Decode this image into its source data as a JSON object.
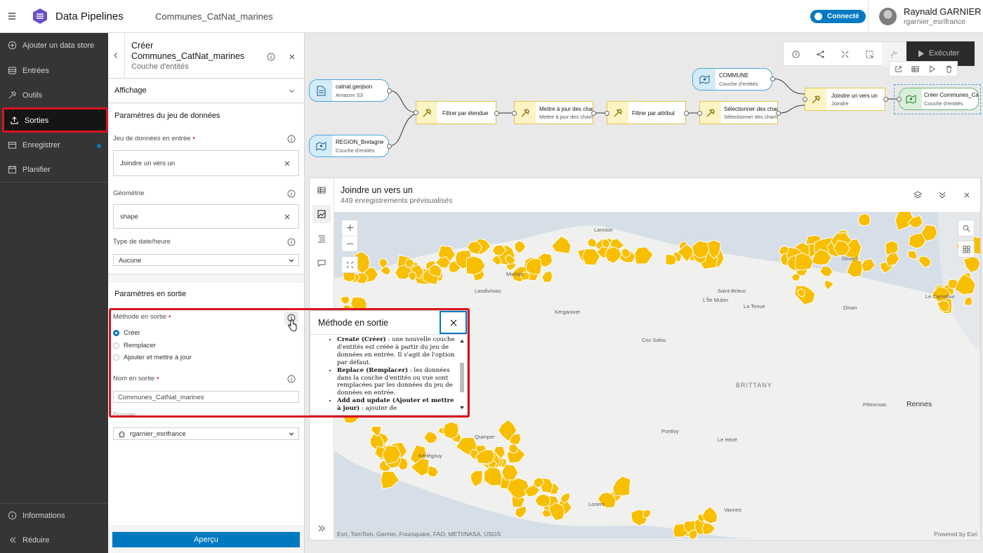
{
  "header": {
    "app_title": "Data Pipelines",
    "pipeline_name": "Communes_CatNat_marines",
    "status_badge": "Connecté",
    "user_name": "Raynald GARNIER",
    "user_login": "rgarnier_esrifrance"
  },
  "sidebar": {
    "items": [
      {
        "label": "Ajouter un data store",
        "icon": "plus-circle-icon"
      },
      {
        "label": "Entrées",
        "icon": "database-icon"
      },
      {
        "label": "Outils",
        "icon": "hammer-icon"
      },
      {
        "label": "Sorties",
        "icon": "export-icon",
        "active": true
      },
      {
        "label": "Enregistrer",
        "icon": "save-icon"
      },
      {
        "label": "Planifier",
        "icon": "calendar-icon"
      }
    ],
    "footer": [
      {
        "label": "Informations",
        "icon": "info-icon"
      },
      {
        "label": "Réduire",
        "icon": "collapse-icon"
      }
    ]
  },
  "panel": {
    "title": "Créer Communes_CatNat_marines",
    "subtitle": "Couche d'entités",
    "display_section": "Affichage",
    "dataset_section": "Paramètres du jeu de données",
    "input_dataset_label": "Jeu de données en entrée",
    "input_dataset_value": "Joindre un vers un",
    "geometry_label": "Géométrie",
    "geometry_value": "shape",
    "datetime_label": "Type de date/heure",
    "datetime_value": "Aucune",
    "output_section": "Paramètres en sortie",
    "output_method_label": "Méthode en sortie",
    "method_options": [
      "Créer",
      "Remplacer",
      "Ajouter et mettre à jour"
    ],
    "output_name_label": "Nom en sortie",
    "output_name_value": "Communes_CatNat_marines",
    "folder_label": "Dossier",
    "folder_value": "rgarnier_esrifrance",
    "preview_button": "Aperçu"
  },
  "toolbar": {
    "execute_label": "Exécuter"
  },
  "diagram": {
    "nodes": [
      {
        "title": "catnat.geojson",
        "subtitle": "Amazon S3"
      },
      {
        "title": "REGION_Bretagne",
        "subtitle": "Couche d'entités"
      },
      {
        "title": "Filtrer par étendue",
        "subtitle": ""
      },
      {
        "title": "Mettre à jour des champs",
        "subtitle": "Mettre à jour des champs"
      },
      {
        "title": "Filtrer par attribut",
        "subtitle": ""
      },
      {
        "title": "Sélectionner des champs",
        "subtitle": "Sélectionner des champs"
      },
      {
        "title": "COMMUNE",
        "subtitle": "Couche d'entités"
      },
      {
        "title": "Joindre un vers un",
        "subtitle": "Joindre"
      },
      {
        "title": "Créer Communes_CatNat_marines",
        "subtitle": "Couche d'entités"
      }
    ]
  },
  "preview": {
    "title": "Joindre un vers un",
    "subtitle": "449 enregistrements prévisualisés",
    "attribution": "Esri, TomTom, Garmin, Foursquare, FAO, METI/NASA, USGS",
    "powered_by": "Powered by Esri",
    "places": [
      "Lannion",
      "Morlaix",
      "Landivisiau",
      "Kerganivet",
      "Dinard",
      "Saint-Brieuc",
      "L'Île Mulon",
      "La Tenue",
      "Dinan",
      "Le Carrefour",
      "Coz Salou",
      "BRITTANY",
      "Pétronsac",
      "Rennes",
      "Pontivy",
      "Le Hézé",
      "Quimper",
      "Kerlégouy",
      "Lorient",
      "Vannes"
    ]
  },
  "popover": {
    "title": "Méthode en sortie",
    "items": [
      {
        "term": "Create (Créer)",
        "text": " : une nouvelle couche d'entités est créée à partir du jeu de données en entrée. Il s'agit de l'option par défaut."
      },
      {
        "term": "Replace (Remplacer)",
        "text": " : les données dans la couche d'entités ou vue sont remplacées par les données du jeu de données en entrée."
      },
      {
        "term": "Add and update (Ajouter et mettre à jour)",
        "text": " : ajouter de"
      }
    ]
  },
  "colors": {
    "accent": "#0079c1",
    "highlight": "#d81320",
    "sidebar_bg": "#353535",
    "feature_fill": "#f8be00"
  }
}
